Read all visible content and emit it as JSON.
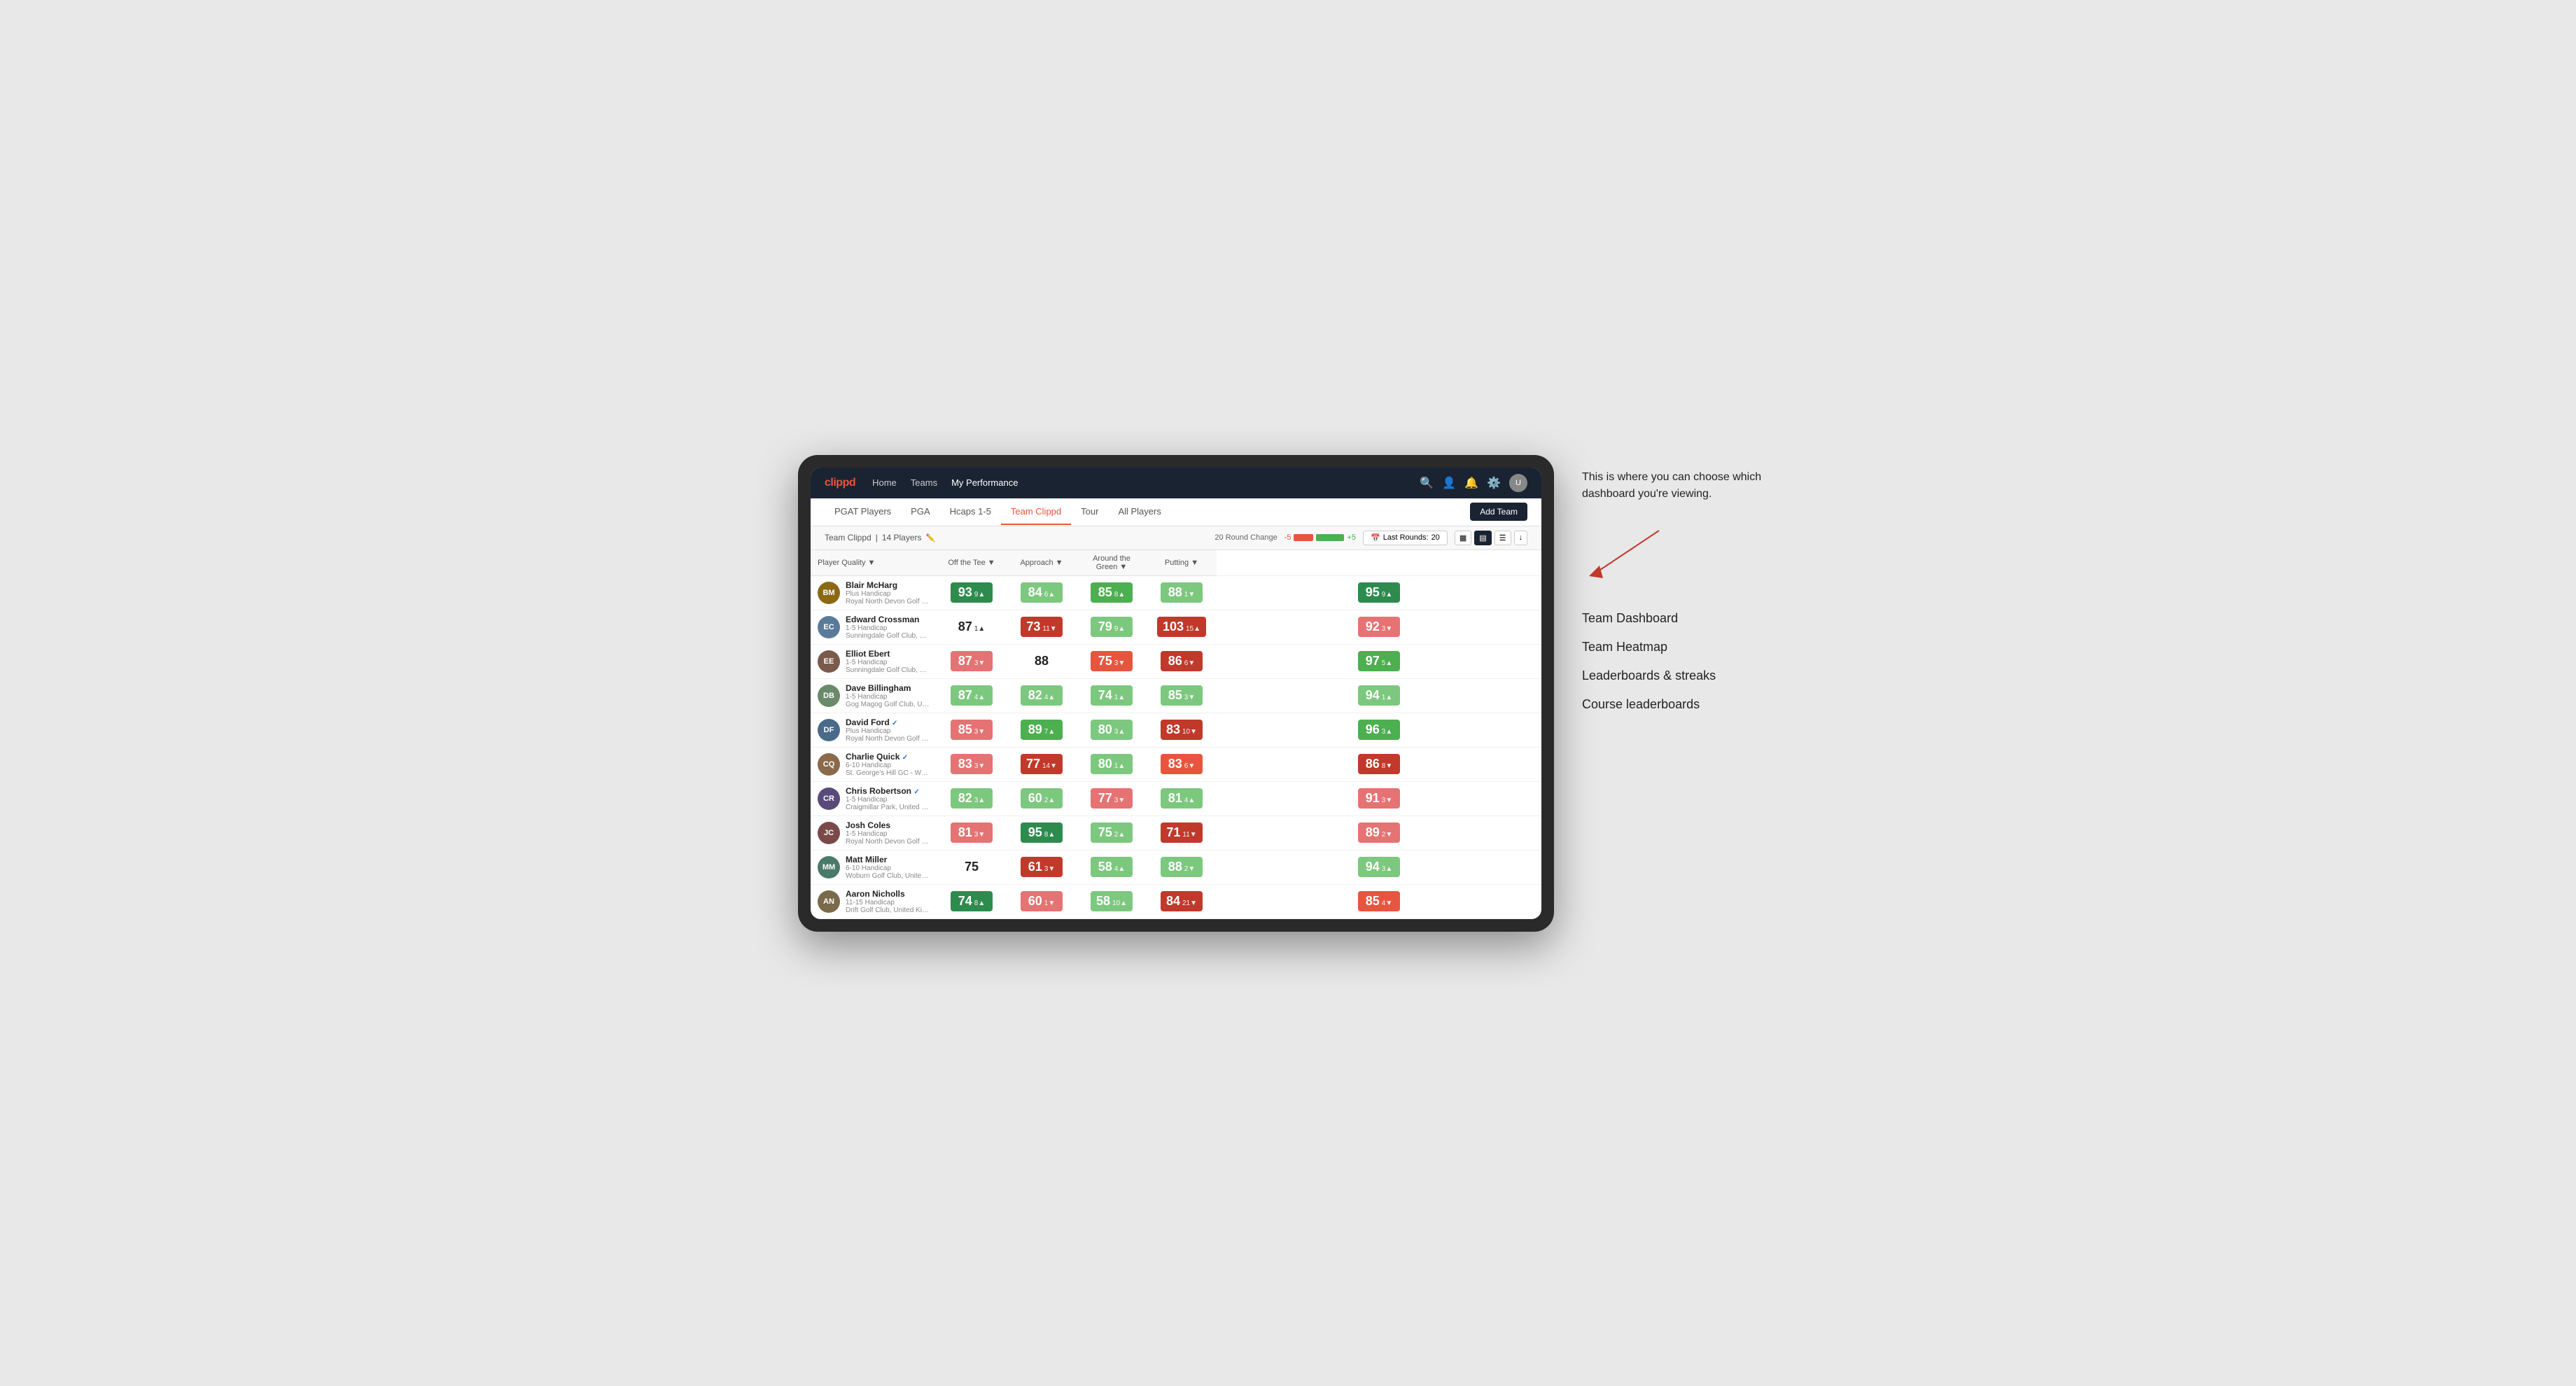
{
  "annotation": {
    "intro_text": "This is where you can choose which dashboard you're viewing.",
    "menu_items": [
      "Team Dashboard",
      "Team Heatmap",
      "Leaderboards & streaks",
      "Course leaderboards"
    ]
  },
  "nav": {
    "logo": "clippd",
    "links": [
      "Home",
      "Teams",
      "My Performance"
    ],
    "active_link": "My Performance"
  },
  "sub_nav": {
    "links": [
      "PGAT Players",
      "PGA",
      "Hcaps 1-5",
      "Team Clippd",
      "Tour",
      "All Players"
    ],
    "active_link": "Team Clippd",
    "add_team_label": "Add Team"
  },
  "team_header": {
    "team_name": "Team Clippd",
    "player_count": "14 Players",
    "round_change_label": "20 Round Change",
    "change_negative": "-5",
    "change_positive": "+5",
    "last_rounds_label": "Last Rounds:",
    "last_rounds_value": "20"
  },
  "table": {
    "columns": [
      "Player Quality ▼",
      "Off the Tee ▼",
      "Approach ▼",
      "Around the Green ▼",
      "Putting ▼"
    ],
    "rows": [
      {
        "name": "Blair McHarg",
        "handicap": "Plus Handicap",
        "club": "Royal North Devon Golf Club, United Kingdom",
        "initials": "BM",
        "avatar_color": "#8B6914",
        "scores": [
          {
            "value": "93",
            "delta": "9",
            "dir": "up",
            "style": "green-dark"
          },
          {
            "value": "84",
            "delta": "6",
            "dir": "up",
            "style": "green-light"
          },
          {
            "value": "85",
            "delta": "8",
            "dir": "up",
            "style": "green-mid"
          },
          {
            "value": "88",
            "delta": "1",
            "dir": "down",
            "style": "green-light"
          },
          {
            "value": "95",
            "delta": "9",
            "dir": "up",
            "style": "green-dark"
          }
        ]
      },
      {
        "name": "Edward Crossman",
        "handicap": "1-5 Handicap",
        "club": "Sunningdale Golf Club, United Kingdom",
        "initials": "EC",
        "avatar_color": "#5a7a9a",
        "scores": [
          {
            "value": "87",
            "delta": "1",
            "dir": "up",
            "style": "white-bg"
          },
          {
            "value": "73",
            "delta": "11",
            "dir": "down",
            "style": "red-dark"
          },
          {
            "value": "79",
            "delta": "9",
            "dir": "up",
            "style": "green-light"
          },
          {
            "value": "103",
            "delta": "15",
            "dir": "up",
            "style": "red-dark"
          },
          {
            "value": "92",
            "delta": "3",
            "dir": "down",
            "style": "red-light"
          }
        ]
      },
      {
        "name": "Elliot Ebert",
        "handicap": "1-5 Handicap",
        "club": "Sunningdale Golf Club, United Kingdom",
        "initials": "EE",
        "avatar_color": "#7a5a4a",
        "scores": [
          {
            "value": "87",
            "delta": "3",
            "dir": "down",
            "style": "red-light"
          },
          {
            "value": "88",
            "delta": "",
            "dir": "",
            "style": "white-bg"
          },
          {
            "value": "75",
            "delta": "3",
            "dir": "down",
            "style": "red-mid"
          },
          {
            "value": "86",
            "delta": "6",
            "dir": "down",
            "style": "red-dark"
          },
          {
            "value": "97",
            "delta": "5",
            "dir": "up",
            "style": "green-mid"
          }
        ]
      },
      {
        "name": "Dave Billingham",
        "handicap": "1-5 Handicap",
        "club": "Gog Magog Golf Club, United Kingdom",
        "initials": "DB",
        "avatar_color": "#6a8a6a",
        "scores": [
          {
            "value": "87",
            "delta": "4",
            "dir": "up",
            "style": "green-light"
          },
          {
            "value": "82",
            "delta": "4",
            "dir": "up",
            "style": "green-light"
          },
          {
            "value": "74",
            "delta": "1",
            "dir": "up",
            "style": "green-light"
          },
          {
            "value": "85",
            "delta": "3",
            "dir": "down",
            "style": "green-light"
          },
          {
            "value": "94",
            "delta": "1",
            "dir": "up",
            "style": "green-light"
          }
        ]
      },
      {
        "name": "David Ford",
        "handicap": "Plus Handicap",
        "club": "Royal North Devon Golf Club, United Kingdom",
        "initials": "DF",
        "avatar_color": "#4a6a8a",
        "verified": true,
        "scores": [
          {
            "value": "85",
            "delta": "3",
            "dir": "down",
            "style": "red-light"
          },
          {
            "value": "89",
            "delta": "7",
            "dir": "up",
            "style": "green-mid"
          },
          {
            "value": "80",
            "delta": "3",
            "dir": "up",
            "style": "green-light"
          },
          {
            "value": "83",
            "delta": "10",
            "dir": "down",
            "style": "red-dark"
          },
          {
            "value": "96",
            "delta": "3",
            "dir": "up",
            "style": "green-mid"
          }
        ]
      },
      {
        "name": "Charlie Quick",
        "handicap": "6-10 Handicap",
        "club": "St. George's Hill GC - Weybridge - Surrey, Uni...",
        "initials": "CQ",
        "avatar_color": "#8a6a4a",
        "verified": true,
        "scores": [
          {
            "value": "83",
            "delta": "3",
            "dir": "down",
            "style": "red-light"
          },
          {
            "value": "77",
            "delta": "14",
            "dir": "down",
            "style": "red-dark"
          },
          {
            "value": "80",
            "delta": "1",
            "dir": "up",
            "style": "green-light"
          },
          {
            "value": "83",
            "delta": "6",
            "dir": "down",
            "style": "red-mid"
          },
          {
            "value": "86",
            "delta": "8",
            "dir": "down",
            "style": "red-dark"
          }
        ]
      },
      {
        "name": "Chris Robertson",
        "handicap": "1-5 Handicap",
        "club": "Craigmillar Park, United Kingdom",
        "initials": "CR",
        "avatar_color": "#5a4a7a",
        "verified": true,
        "scores": [
          {
            "value": "82",
            "delta": "3",
            "dir": "up",
            "style": "green-light"
          },
          {
            "value": "60",
            "delta": "2",
            "dir": "up",
            "style": "green-light"
          },
          {
            "value": "77",
            "delta": "3",
            "dir": "down",
            "style": "red-light"
          },
          {
            "value": "81",
            "delta": "4",
            "dir": "up",
            "style": "green-light"
          },
          {
            "value": "91",
            "delta": "3",
            "dir": "down",
            "style": "red-light"
          }
        ]
      },
      {
        "name": "Josh Coles",
        "handicap": "1-5 Handicap",
        "club": "Royal North Devon Golf Club, United Kingdom",
        "initials": "JC",
        "avatar_color": "#7a4a4a",
        "scores": [
          {
            "value": "81",
            "delta": "3",
            "dir": "down",
            "style": "red-light"
          },
          {
            "value": "95",
            "delta": "8",
            "dir": "up",
            "style": "green-dark"
          },
          {
            "value": "75",
            "delta": "2",
            "dir": "up",
            "style": "green-light"
          },
          {
            "value": "71",
            "delta": "11",
            "dir": "down",
            "style": "red-dark"
          },
          {
            "value": "89",
            "delta": "2",
            "dir": "down",
            "style": "red-light"
          }
        ]
      },
      {
        "name": "Matt Miller",
        "handicap": "6-10 Handicap",
        "club": "Woburn Golf Club, United Kingdom",
        "initials": "MM",
        "avatar_color": "#4a7a6a",
        "scores": [
          {
            "value": "75",
            "delta": "",
            "dir": "",
            "style": "white-bg"
          },
          {
            "value": "61",
            "delta": "3",
            "dir": "down",
            "style": "red-dark"
          },
          {
            "value": "58",
            "delta": "4",
            "dir": "up",
            "style": "green-light"
          },
          {
            "value": "88",
            "delta": "2",
            "dir": "down",
            "style": "green-light"
          },
          {
            "value": "94",
            "delta": "3",
            "dir": "up",
            "style": "green-light"
          }
        ]
      },
      {
        "name": "Aaron Nicholls",
        "handicap": "11-15 Handicap",
        "club": "Drift Golf Club, United Kingdom",
        "initials": "AN",
        "avatar_color": "#7a6a4a",
        "scores": [
          {
            "value": "74",
            "delta": "8",
            "dir": "up",
            "style": "green-dark"
          },
          {
            "value": "60",
            "delta": "1",
            "dir": "down",
            "style": "red-light"
          },
          {
            "value": "58",
            "delta": "10",
            "dir": "up",
            "style": "green-light"
          },
          {
            "value": "84",
            "delta": "21",
            "dir": "down",
            "style": "red-dark"
          },
          {
            "value": "85",
            "delta": "4",
            "dir": "down",
            "style": "red-mid"
          }
        ]
      }
    ]
  }
}
